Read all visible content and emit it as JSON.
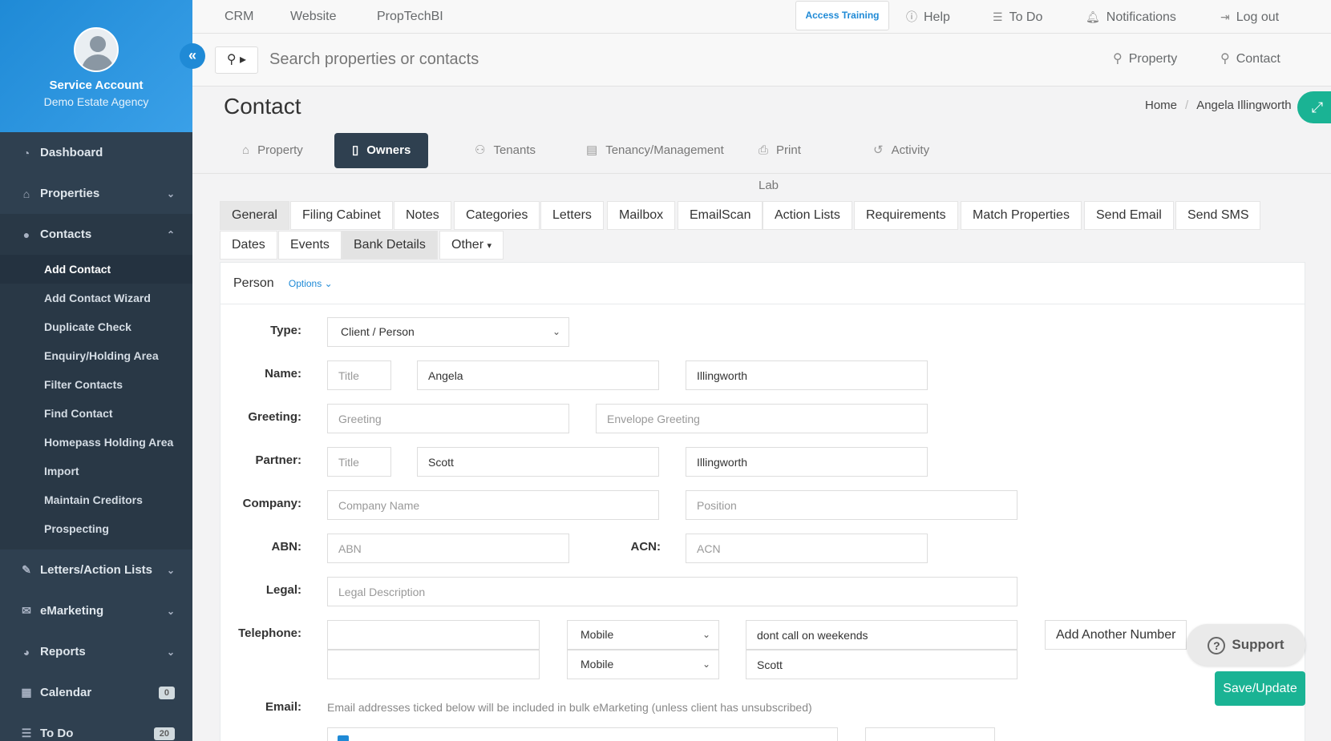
{
  "sidebar": {
    "account_name": "Service Account",
    "agency": "Demo Estate Agency",
    "nav": [
      {
        "label": "Dashboard",
        "icon": "dashboard-icon"
      },
      {
        "label": "Properties",
        "icon": "home-icon"
      },
      {
        "label": "Contacts",
        "icon": "user-icon"
      }
    ],
    "contacts_sub": [
      "Add Contact",
      "Add Contact Wizard",
      "Duplicate Check",
      "Enquiry/Holding Area",
      "Filter Contacts",
      "Find Contact",
      "Homepass Holding Area",
      "Import",
      "Maintain Creditors",
      "Prospecting"
    ],
    "nav_bottom": [
      {
        "label": "Letters/Action Lists",
        "icon": "edit-icon"
      },
      {
        "label": "eMarketing",
        "icon": "envelope-icon"
      },
      {
        "label": "Reports",
        "icon": "pie-chart-icon"
      },
      {
        "label": "Calendar",
        "icon": "calendar-icon",
        "badge": "0"
      },
      {
        "label": "To Do",
        "icon": "list-icon",
        "badge": "20"
      }
    ]
  },
  "topbar": {
    "left": [
      "CRM",
      "Website",
      "PropTechBI"
    ],
    "access_training": "Access Training",
    "help": "Help",
    "todo": "To Do",
    "notifications": "Notifications",
    "logout": "Log out"
  },
  "search": {
    "placeholder": "Search properties or contacts",
    "property": "Property",
    "contact": "Contact"
  },
  "page": {
    "title": "Contact",
    "breadcrumb_home": "Home",
    "breadcrumb_current": "Angela Illingworth"
  },
  "main_tabs": [
    {
      "label": "Property",
      "icon": "home-icon"
    },
    {
      "label": "Owners",
      "icon": "file-icon"
    },
    {
      "label": "Tenants",
      "icon": "users-icon"
    },
    {
      "label": "Tenancy/Management",
      "icon": "calculator-icon"
    },
    {
      "label": "Print Lab",
      "icon": "print-icon"
    },
    {
      "label": "Activity",
      "icon": "history-icon"
    }
  ],
  "sub_tabs_row1": [
    "General",
    "Filing Cabinet",
    "Notes",
    "Categories",
    "Letters",
    "Mailbox",
    "EmailScan",
    "Action Lists",
    "Requirements",
    "Match Properties",
    "Send Email",
    "Send SMS"
  ],
  "sub_tabs_row2": [
    "Dates",
    "Events",
    "Bank Details",
    "Other"
  ],
  "form": {
    "panel_title": "Person",
    "options": "Options",
    "labels": {
      "type": "Type:",
      "name": "Name:",
      "greeting": "Greeting:",
      "partner": "Partner:",
      "company": "Company:",
      "abn": "ABN:",
      "acn": "ACN:",
      "legal": "Legal:",
      "telephone": "Telephone:",
      "email": "Email:"
    },
    "type_value": "Client / Person",
    "name_title_ph": "Title",
    "name_first": "Angela",
    "name_last": "Illingworth",
    "greeting_ph": "Greeting",
    "envelope_ph": "Envelope Greeting",
    "partner_title_ph": "Title",
    "partner_first": "Scott",
    "partner_last": "Illingworth",
    "company_ph": "Company Name",
    "position_ph": "Position",
    "abn_ph": "ABN",
    "acn_ph": "ACN",
    "legal_ph": "Legal Description",
    "phones": [
      {
        "type": "Mobile",
        "note": "dont call on weekends"
      },
      {
        "type": "Mobile",
        "note": "Scott"
      }
    ],
    "add_number": "Add Another Number",
    "email_note": "Email addresses ticked below will be included in bulk eMarketing (unless client has unsubscribed)"
  },
  "support": "Support",
  "save": "Save/Update"
}
